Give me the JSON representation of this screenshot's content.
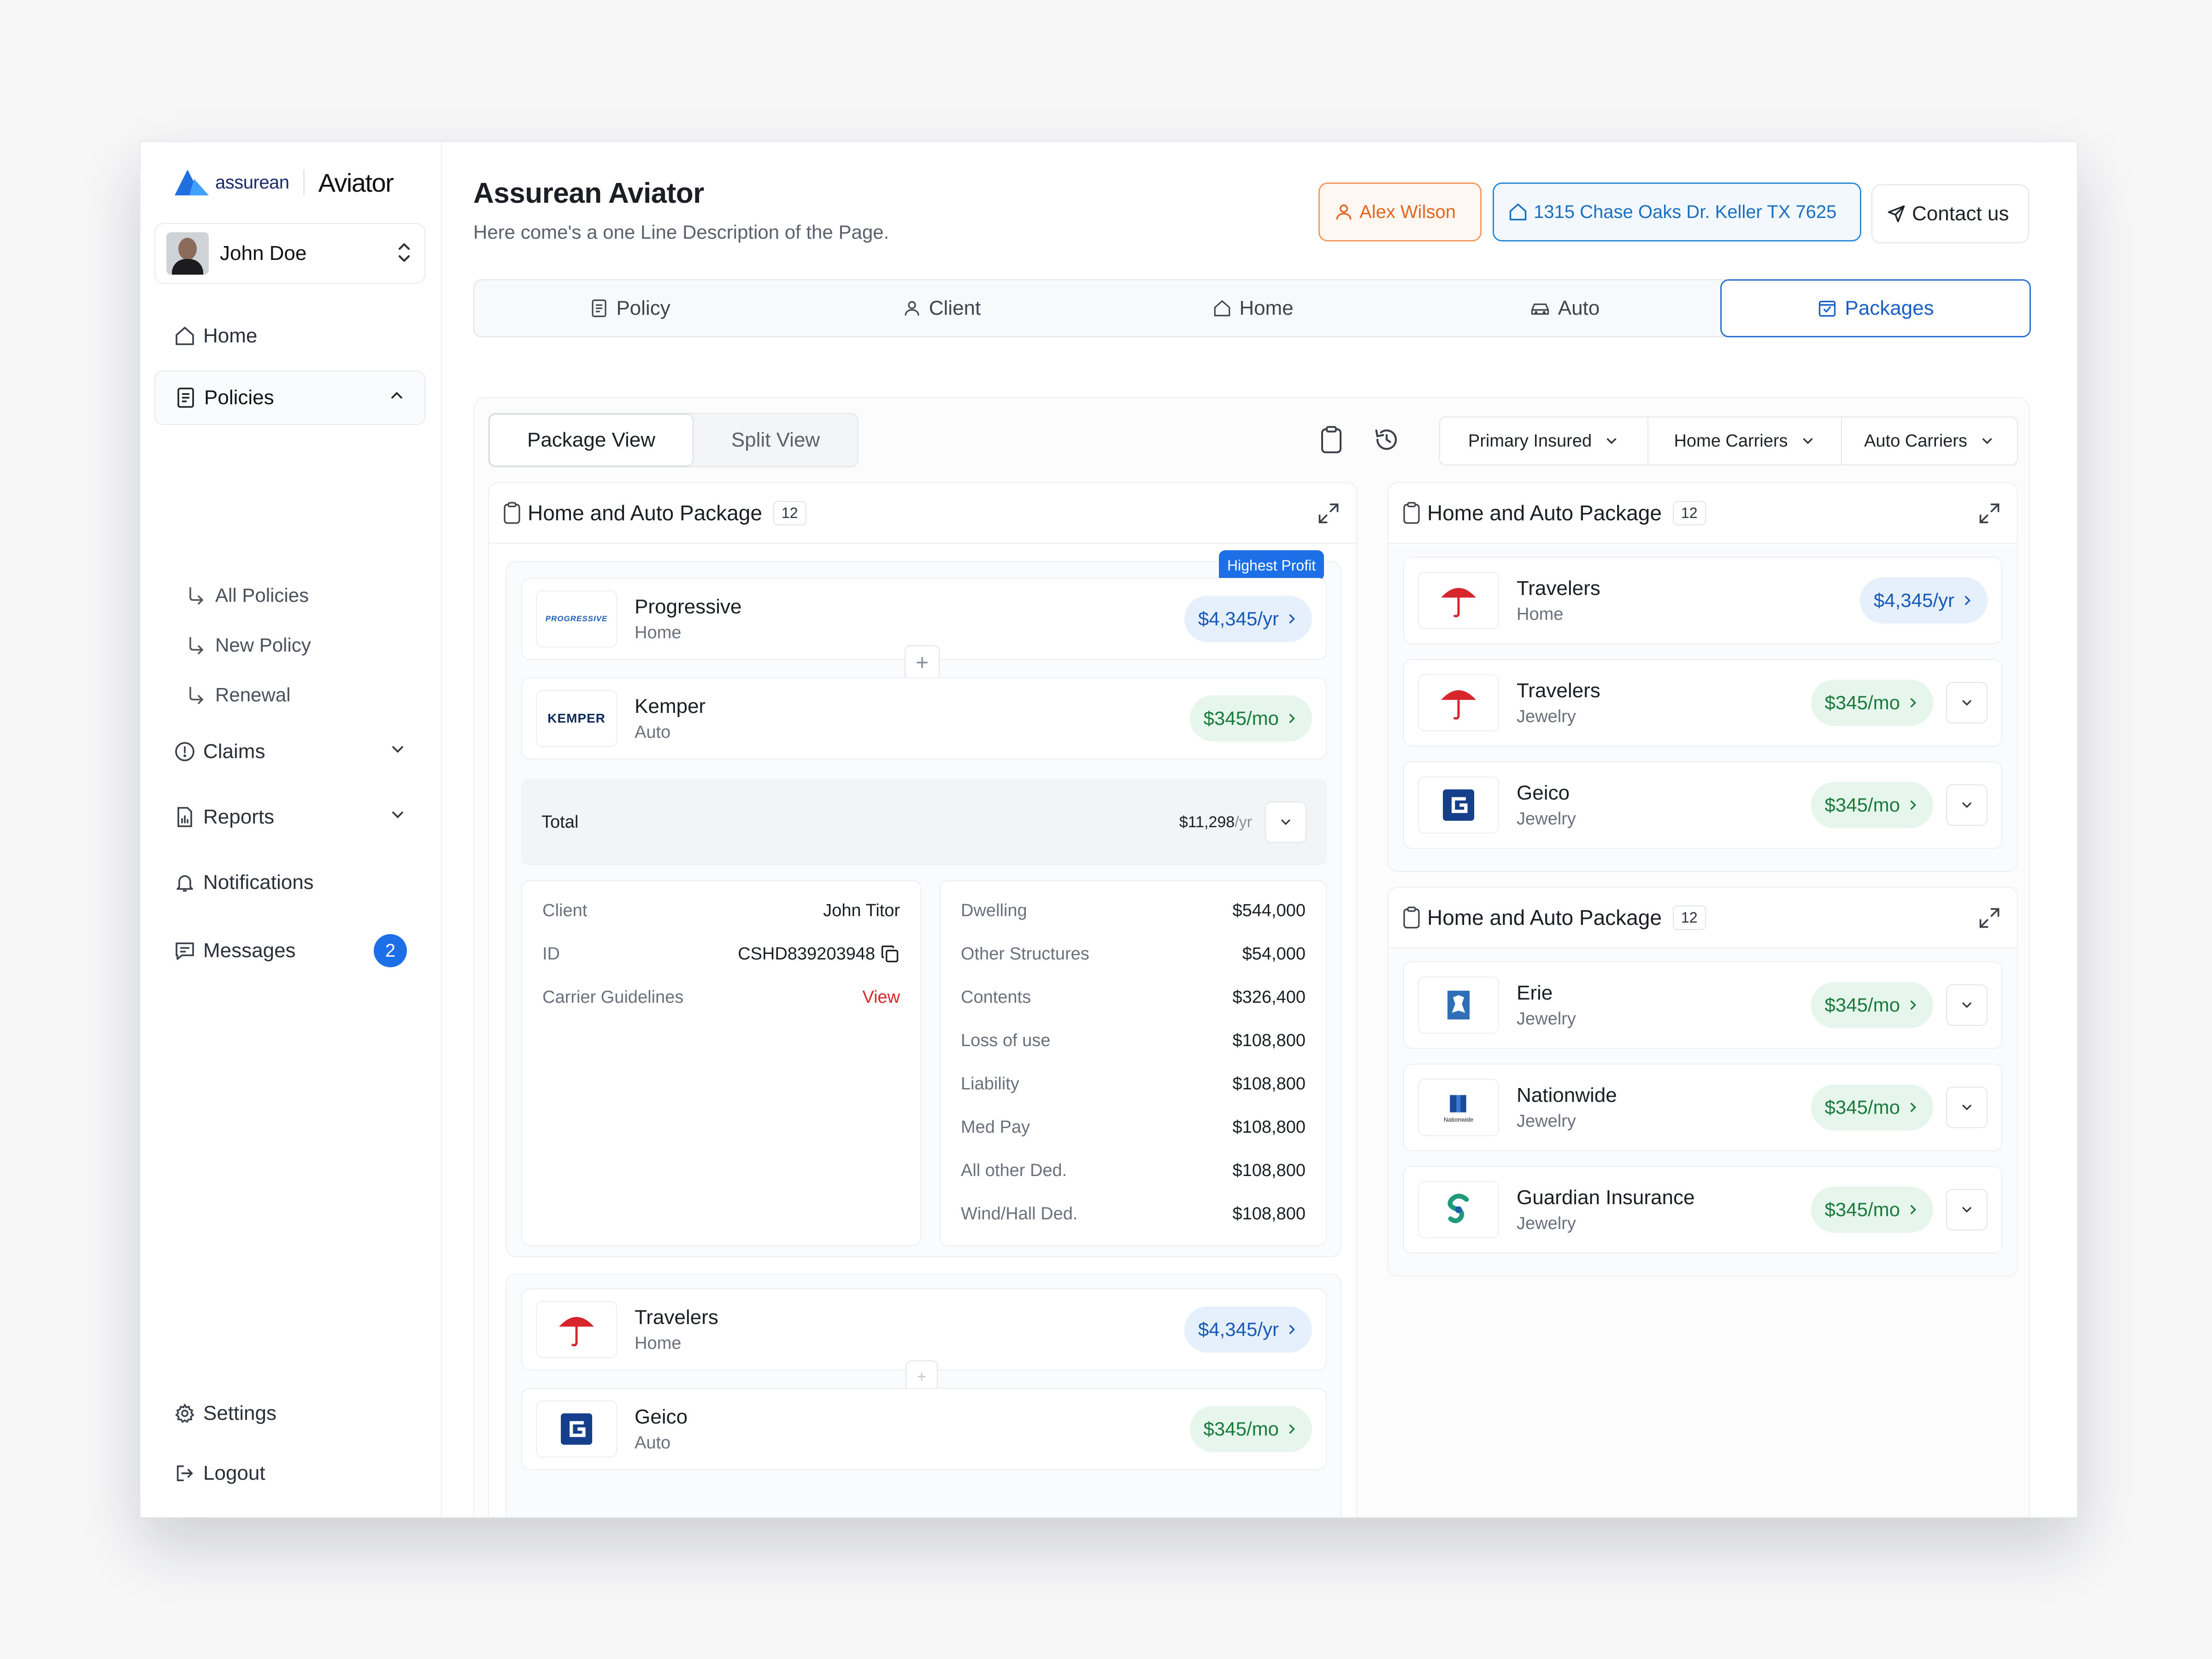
{
  "brand": {
    "word": "assurean",
    "app_name": "Aviator"
  },
  "user": {
    "name": "John Doe"
  },
  "nav": {
    "home": "Home",
    "policies": "Policies",
    "policies_sub": [
      "All Policies",
      "New Policy",
      "Renewal"
    ],
    "claims": "Claims",
    "reports": "Reports",
    "notifications": "Notifications",
    "messages": "Messages",
    "messages_count": "2",
    "settings": "Settings",
    "logout": "Logout"
  },
  "header": {
    "title": "Assurean Aviator",
    "description": "Here come's a one Line Description of the Page.",
    "client_chip": "Alex Wilson",
    "address_chip": "1315 Chase Oaks Dr. Keller TX 7625",
    "contact": "Contact us"
  },
  "tabs": [
    "Policy",
    "Client",
    "Home",
    "Auto",
    "Packages"
  ],
  "view": {
    "package_view": "Package View",
    "split_view": "Split View"
  },
  "filters": [
    "Primary Insured",
    "Home Carriers",
    "Auto Carriers"
  ],
  "left_column": {
    "title": "Home and Auto Package",
    "count": "12",
    "ribbon": "Highest Profit",
    "package1": {
      "carriers": [
        {
          "name": "Progressive",
          "type": "Home",
          "price": "$4,345/yr",
          "logo_text": "PROGRESSIVE"
        },
        {
          "name": "Kemper",
          "type": "Auto",
          "price": "$345/mo",
          "logo_text": "KEMPER"
        }
      ],
      "total_label": "Total",
      "total_value": "$11,298",
      "total_unit": "/yr",
      "client_details": [
        {
          "k": "Client",
          "v": "John Titor"
        },
        {
          "k": "ID",
          "v": "CSHD839203948"
        },
        {
          "k": "Carrier Guidelines",
          "v": "View"
        }
      ],
      "coverage": [
        {
          "k": "Dwelling",
          "v": "$544,000"
        },
        {
          "k": "Other Structures",
          "v": "$54,000"
        },
        {
          "k": "Contents",
          "v": "$326,400"
        },
        {
          "k": "Loss of use",
          "v": "$108,800"
        },
        {
          "k": "Liability",
          "v": "$108,800"
        },
        {
          "k": "Med Pay",
          "v": "$108,800"
        },
        {
          "k": "All other Ded.",
          "v": "$108,800"
        },
        {
          "k": "Wind/Hall Ded.",
          "v": "$108,800"
        }
      ]
    },
    "package2": {
      "carriers": [
        {
          "name": "Travelers",
          "type": "Home",
          "price": "$4,345/yr"
        },
        {
          "name": "Geico",
          "type": "Auto",
          "price": "$345/mo"
        }
      ]
    }
  },
  "right_top": {
    "title": "Home and Auto Package",
    "count": "12",
    "carriers": [
      {
        "name": "Travelers",
        "type": "Home",
        "price": "$4,345/yr"
      },
      {
        "name": "Travelers",
        "type": "Jewelry",
        "price": "$345/mo"
      },
      {
        "name": "Geico",
        "type": "Jewelry",
        "price": "$345/mo"
      }
    ]
  },
  "right_bottom": {
    "title": "Home and Auto Package",
    "count": "12",
    "carriers": [
      {
        "name": "Erie",
        "type": "Jewelry",
        "price": "$345/mo"
      },
      {
        "name": "Nationwide",
        "type": "Jewelry",
        "price": "$345/mo",
        "logo_text": "Nationwide"
      },
      {
        "name": "Guardian Insurance",
        "type": "Jewelry",
        "price": "$345/mo"
      }
    ]
  },
  "colors": {
    "accent": "#1d6fe8",
    "orange": "#e4651e",
    "green": "#1a7a3c"
  }
}
